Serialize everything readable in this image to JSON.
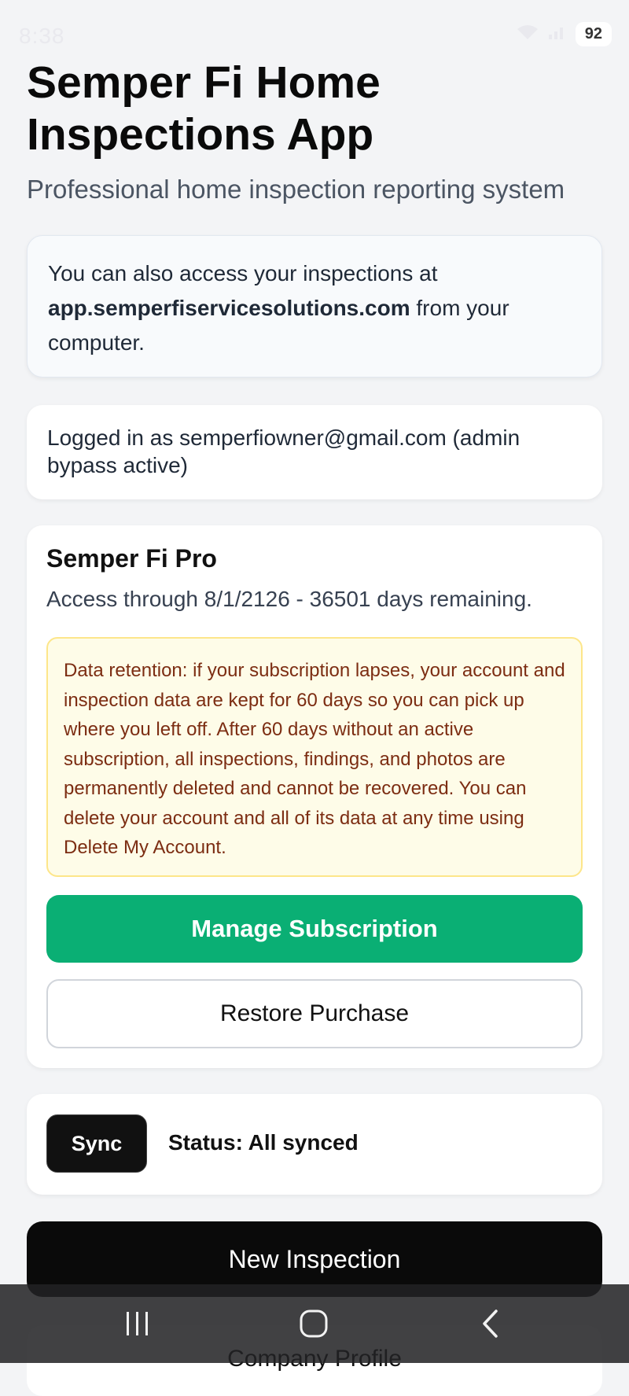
{
  "status_bar": {
    "time": "8:38",
    "battery": "92"
  },
  "header": {
    "title": "Semper Fi Home Inspections App",
    "subtitle": "Professional home inspection reporting system"
  },
  "info_card": {
    "text_before": "You can also access your inspections at ",
    "link": "app.semperfiservicesolutions.com",
    "text_after": " from your computer."
  },
  "login": {
    "text": "Logged in as semperfiowner@gmail.com (admin bypass active)"
  },
  "subscription": {
    "plan_name": "Semper Fi Pro",
    "access": "Access through 8/1/2126 - 36501 days remaining.",
    "retention_notice": "Data retention: if your subscription lapses, your account and inspection data are kept for 60 days so you can pick up where you left off. After 60 days without an active subscription, all inspections, findings, and photos are permanently deleted and cannot be recovered. You can delete your account and all of its data at any time using Delete My Account.",
    "manage_label": "Manage Subscription",
    "restore_label": "Restore Purchase"
  },
  "sync": {
    "button_label": "Sync",
    "status": "Status: All synced"
  },
  "actions": {
    "new_inspection_label": "New Inspection",
    "company_profile_label": "Company Profile"
  },
  "colors": {
    "accent_green": "#0aaf74",
    "primary_dark": "#0a0a0a",
    "notice_background": "#fefce8",
    "notice_text": "#7c2d12"
  },
  "icons": {
    "nav_recents": "recents-icon",
    "nav_home": "home-icon",
    "nav_back": "back-icon"
  }
}
